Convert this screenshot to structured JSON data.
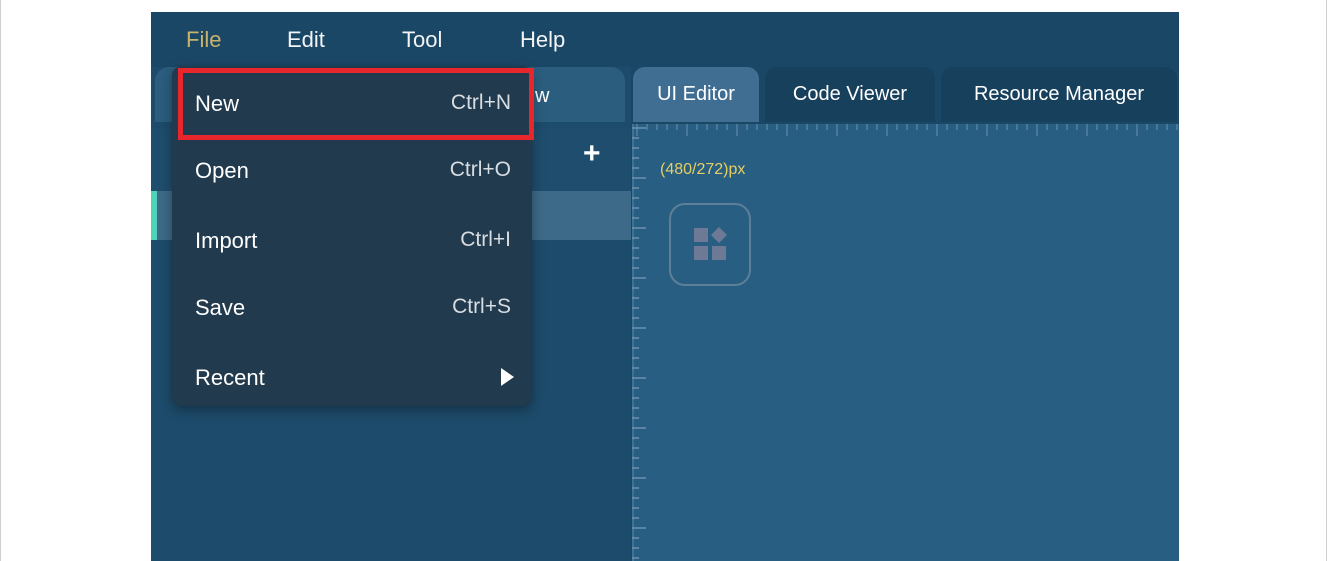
{
  "menubar": {
    "items": [
      "File",
      "Edit",
      "Tool",
      "Help"
    ]
  },
  "left_panel": {
    "tab_label_fragment": "w"
  },
  "editor_tabs": [
    "UI Editor",
    "Code Viewer",
    "Resource Manager"
  ],
  "canvas": {
    "size_label": "(480/272)px"
  },
  "file_menu": {
    "items": [
      {
        "label": "New",
        "shortcut": "Ctrl+N"
      },
      {
        "label": "Open",
        "shortcut": "Ctrl+O"
      },
      {
        "label": "Import",
        "shortcut": "Ctrl+I"
      },
      {
        "label": "Save",
        "shortcut": "Ctrl+S"
      },
      {
        "label": "Recent",
        "shortcut": ""
      }
    ]
  },
  "colors": {
    "app_bg": "#1b4766",
    "active_menu": "#c9b26a",
    "highlight": "#e8262b",
    "accent": "#4fd2b7",
    "size_label": "#e6cf62"
  },
  "icons": {
    "plus": "plus-icon",
    "submenu": "chevron-right-icon",
    "widget": "widgets-icon"
  }
}
